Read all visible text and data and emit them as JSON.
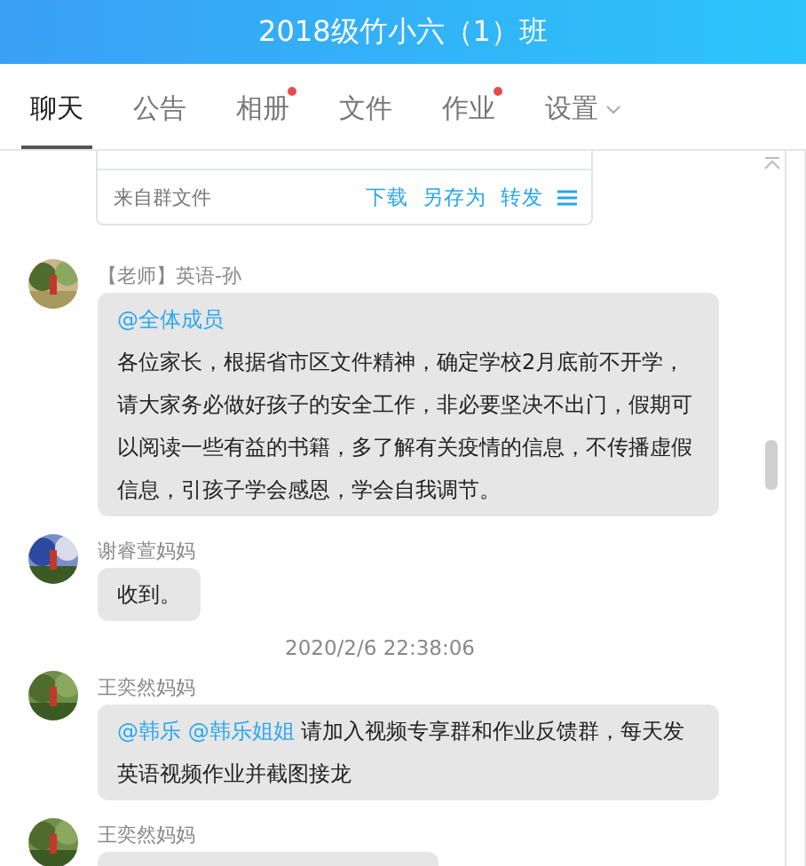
{
  "window": {
    "title": "2018级竹小六（1）班"
  },
  "tabs": [
    {
      "label": "聊天",
      "selected": true,
      "unread": false,
      "menu": false
    },
    {
      "label": "公告",
      "selected": false,
      "unread": false,
      "menu": false
    },
    {
      "label": "相册",
      "selected": false,
      "unread": true,
      "menu": false
    },
    {
      "label": "文件",
      "selected": false,
      "unread": false,
      "menu": false
    },
    {
      "label": "作业",
      "selected": false,
      "unread": true,
      "menu": false
    },
    {
      "label": "设置",
      "selected": false,
      "unread": false,
      "menu": true
    }
  ],
  "file_card": {
    "source": "来自群文件",
    "actions": [
      "下载",
      "另存为",
      "转发"
    ]
  },
  "messages": [
    {
      "kind": "message",
      "sender": "【老师】英语-孙",
      "mentions": [
        "@全体成员"
      ],
      "mentions_own_line": true,
      "text": "各位家长，根据省市区文件精神，确定学校2月底前不开学，请大家务必做好孩子的安全工作，非必要坚决不出门，假期可以阅读一些有益的书籍，多了解有关疫情的信息，不传播虚假信息，引孩子学会感恩，学会自我调节。"
    },
    {
      "kind": "message",
      "sender": "谢睿萱妈妈",
      "text": "收到。"
    },
    {
      "kind": "time",
      "text": "2020/2/6 22:38:06"
    },
    {
      "kind": "message",
      "sender": "王奕然妈妈",
      "mentions": [
        "@韩乐",
        "@韩乐姐姐"
      ],
      "mentions_own_line": false,
      "text": "请加入视频专享群和作业反馈群，每天发英语视频作业并截图接龙"
    },
    {
      "kind": "message",
      "sender": "王奕然妈妈"
    }
  ]
}
